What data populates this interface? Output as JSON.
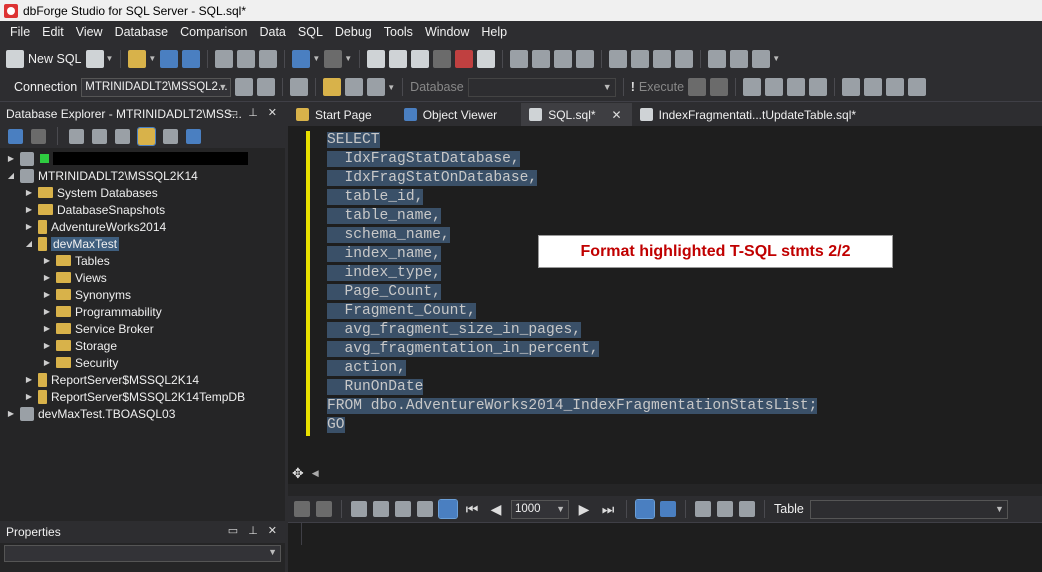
{
  "window": {
    "title": "dbForge Studio for SQL Server - SQL.sql*"
  },
  "menu": [
    "File",
    "Edit",
    "View",
    "Database",
    "Comparison",
    "Data",
    "SQL",
    "Debug",
    "Tools",
    "Window",
    "Help"
  ],
  "toolbar": {
    "new_sql_label": "New SQL",
    "connection_label": "Connection",
    "connection_value": "MTRINIDADLT2\\MSSQL2...",
    "database_label": "Database",
    "execute_label": "Execute"
  },
  "explorer": {
    "title": "Database Explorer - MTRINIDADLT2\\MSS...",
    "server": "MTRINIDADLT2\\MSSQL2K14",
    "items": [
      "System Databases",
      "DatabaseSnapshots",
      "AdventureWorks2014",
      "devMaxTest"
    ],
    "devmaxtest_children": [
      "Tables",
      "Views",
      "Synonyms",
      "Programmability",
      "Service Broker",
      "Storage",
      "Security"
    ],
    "more_items": [
      "ReportServer$MSSQL2K14",
      "ReportServer$MSSQL2K14TempDB"
    ],
    "other_connection": "devMaxTest.TBOASQL03"
  },
  "properties": {
    "title": "Properties"
  },
  "tabs": [
    {
      "label": "Start Page",
      "icon": "start-page-icon"
    },
    {
      "label": "Object Viewer",
      "icon": "object-viewer-icon"
    },
    {
      "label": "SQL.sql*",
      "icon": "sql-file-icon"
    },
    {
      "label": "IndexFragmentati...tUpdateTable.sql*",
      "icon": "sql-file-icon"
    }
  ],
  "editor": {
    "lines": [
      "SELECT",
      "  IdxFragStatDatabase,",
      "  IdxFragStatOnDatabase,",
      "  table_id,",
      "  table_name,",
      "  schema_name,",
      "  index_name,",
      "  index_type,",
      "  Page_Count,",
      "  Fragment_Count,",
      "  avg_fragment_size_in_pages,",
      "  avg_fragmentation_in_percent,",
      "  action,",
      "  RunOnDate",
      "FROM dbo.AdventureWorks2014_IndexFragmentationStatsList;",
      "GO"
    ]
  },
  "overlay": {
    "text": "Format highlighted T-SQL stmts 2/2"
  },
  "results": {
    "rows_value": "1000",
    "table_label": "Table"
  },
  "colors": {
    "accent": "#c00000",
    "selection": "#3a5068",
    "gutter_mark": "#e8e000"
  }
}
